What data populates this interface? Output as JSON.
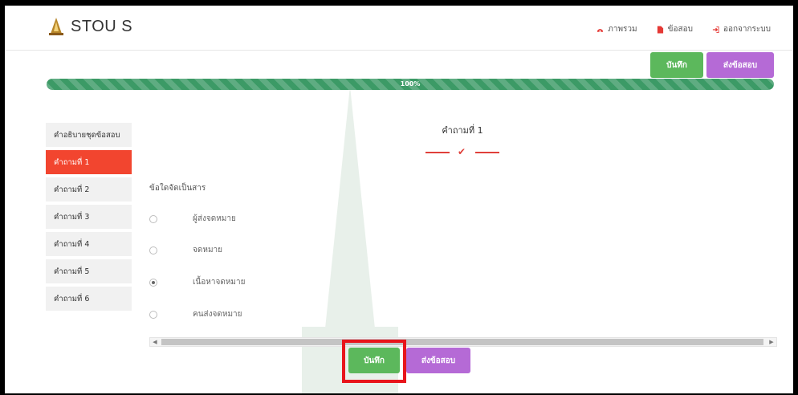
{
  "app": {
    "brand": "STOU S"
  },
  "topnav": [
    {
      "label": "ภาพรวม",
      "icon": "dashboard-icon"
    },
    {
      "label": "ข้อสอบ",
      "icon": "file-icon"
    },
    {
      "label": "ออกจากระบบ",
      "icon": "logout-icon"
    }
  ],
  "actions": {
    "save_label": "บันทึก",
    "send_label": "ส่งข้อสอบ"
  },
  "progress": {
    "label": "100%",
    "value": 100
  },
  "sidebar": {
    "items": [
      {
        "label": "คำอธิบายชุดข้อสอบ",
        "active": false
      },
      {
        "label": "คำถามที่ 1",
        "active": true
      },
      {
        "label": "คำถามที่ 2",
        "active": false
      },
      {
        "label": "คำถามที่ 3",
        "active": false
      },
      {
        "label": "คำถามที่ 4",
        "active": false
      },
      {
        "label": "คำถามที่ 5",
        "active": false
      },
      {
        "label": "คำถามที่ 6",
        "active": false
      }
    ]
  },
  "question": {
    "title": "คำถามที่ 1",
    "text": "ข้อใดจัดเป็นสาร",
    "choices": [
      {
        "label": "ผู้ส่งจดหมาย",
        "checked": false
      },
      {
        "label": "จดหมาย",
        "checked": false
      },
      {
        "label": "เนื้อหาจดหมาย",
        "checked": true
      },
      {
        "label": "คนส่งจดหมาย",
        "checked": false
      }
    ]
  },
  "colors": {
    "save": "#5cb85c",
    "send": "#b56ad6",
    "active": "#f2452f",
    "progress": "#3c9a66",
    "highlight": "#e8141b"
  }
}
